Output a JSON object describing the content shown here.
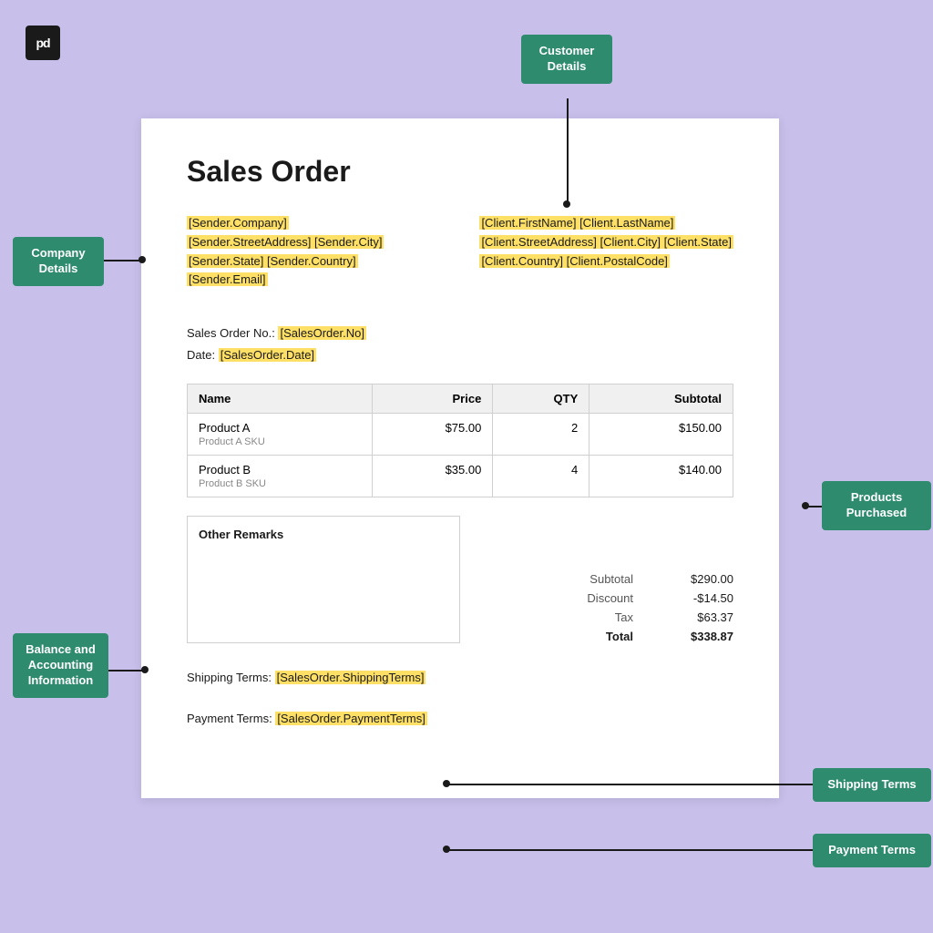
{
  "logo": "pd",
  "document": {
    "title": "Sales Order",
    "sender": {
      "company": "[Sender.Company]",
      "street_city": "[Sender.StreetAddress] [Sender.City]",
      "state_country": "[Sender.State] [Sender.Country]",
      "email": "[Sender.Email]"
    },
    "client": {
      "name": "[Client.FirstName] [Client.LastName]",
      "street_city_state": "[Client.StreetAddress] [Client.City] [Client.State]",
      "country_postal": "[Client.Country] [Client.PostalCode]"
    },
    "order_no_label": "Sales Order No.:",
    "order_no_value": "[SalesOrder.No]",
    "date_label": "Date:",
    "date_value": "[SalesOrder.Date]",
    "table": {
      "headers": [
        "Name",
        "Price",
        "QTY",
        "Subtotal"
      ],
      "rows": [
        {
          "name": "Product A",
          "sku": "Product A SKU",
          "price": "$75.00",
          "qty": "2",
          "subtotal": "$150.00"
        },
        {
          "name": "Product B",
          "sku": "Product B SKU",
          "price": "$35.00",
          "qty": "4",
          "subtotal": "$140.00"
        }
      ]
    },
    "remarks_label": "Other Remarks",
    "totals": {
      "subtotal_label": "Subtotal",
      "subtotal_value": "$290.00",
      "discount_label": "Discount",
      "discount_value": "-$14.50",
      "tax_label": "Tax",
      "tax_value": "$63.37",
      "total_label": "Total",
      "total_value": "$338.87"
    },
    "shipping_terms_label": "Shipping Terms:",
    "shipping_terms_value": "[SalesOrder.ShippingTerms]",
    "payment_terms_label": "Payment Terms:",
    "payment_terms_value": "[SalesOrder.PaymentTerms]"
  },
  "annotations": {
    "customer_details": "Customer\nDetails",
    "company_details": "Company\nDetails",
    "products_purchased": "Products\nPurchased",
    "balance_accounting": "Balance and\nAccounting\nInformation",
    "shipping_terms": "Shipping Terms",
    "payment_terms": "Payment Terms"
  }
}
